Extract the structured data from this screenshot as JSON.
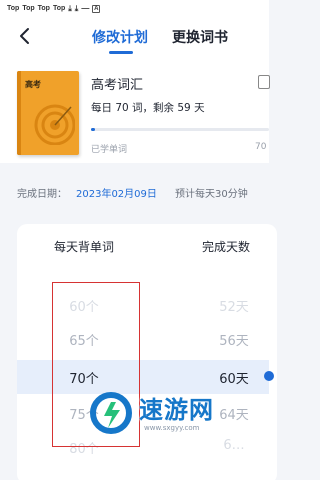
{
  "status_bar": {
    "items": [
      "Top",
      "Top",
      "Top",
      "Top"
    ],
    "icons": [
      "download-icon",
      "download-icon",
      "minus-icon",
      "a-badge-icon"
    ]
  },
  "nav": {
    "tabs": [
      {
        "label": "修改计划",
        "active": true
      },
      {
        "label": "更换词书",
        "active": false
      }
    ]
  },
  "book": {
    "cover_title": "高考",
    "title": "高考词汇",
    "daily_info": "每日 70 词，剩余 59 天",
    "progress_fraction": 0.02,
    "learned_label": "已学单词",
    "learned_value": "70"
  },
  "schedule": {
    "date_label": "完成日期：",
    "date_value": "2023年02月09日",
    "estimate": "预计每天30分钟"
  },
  "picker": {
    "words_header": "每天背单词",
    "days_header": "完成天数",
    "words": [
      "60个",
      "65个",
      "70个",
      "75个",
      "80个"
    ],
    "days": [
      "52天",
      "56天",
      "60天",
      "64天",
      "6…"
    ]
  },
  "watermark": {
    "text": "速游网",
    "url": "www.sxgyy.com"
  },
  "colors": {
    "accent": "#1f6bd6",
    "cover": "#f0a12a",
    "highlight": "#e6eefb",
    "annotation": "#d63333"
  }
}
